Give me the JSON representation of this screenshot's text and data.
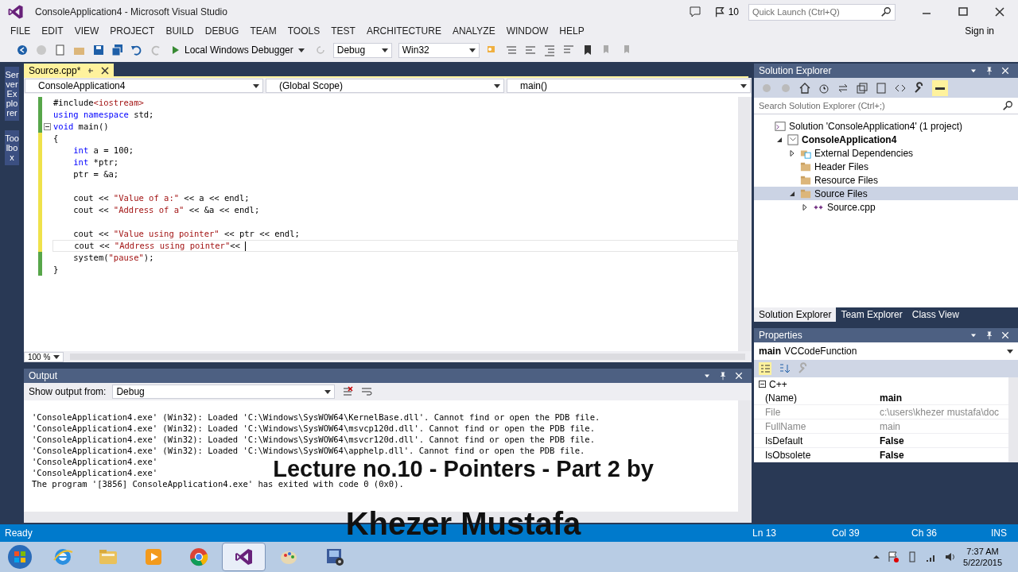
{
  "window": {
    "title": "ConsoleApplication4 - Microsoft Visual Studio",
    "notifications": "10",
    "quick_launch": {
      "placeholder": "Quick Launch (Ctrl+Q)"
    }
  },
  "menu": [
    "FILE",
    "EDIT",
    "VIEW",
    "PROJECT",
    "BUILD",
    "DEBUG",
    "TEAM",
    "TOOLS",
    "TEST",
    "ARCHITECTURE",
    "ANALYZE",
    "WINDOW",
    "HELP"
  ],
  "sign_in": "Sign in",
  "toolbar": {
    "debugger": "Local Windows Debugger",
    "configuration": "Debug",
    "platform": "Win32"
  },
  "side_tabs": [
    "Server Explorer",
    "Toolbox"
  ],
  "editor": {
    "tab": {
      "label": "Source.cpp*",
      "selected": true
    },
    "nav": [
      "ConsoleApplication4",
      "(Global Scope)",
      "main()"
    ],
    "lines": [
      {
        "modified": false,
        "tokens": [
          {
            "kind": "plain",
            "text": "#include"
          },
          {
            "kind": "string",
            "text": "<iostream>"
          }
        ]
      },
      {
        "modified": false,
        "tokens": [
          {
            "kind": "keyword",
            "text": "using namespace"
          },
          {
            "kind": "plain",
            "text": " std;"
          }
        ]
      },
      {
        "modified": false,
        "fold": true,
        "tokens": [
          {
            "kind": "keyword",
            "text": "void"
          },
          {
            "kind": "plain",
            "text": " main()"
          }
        ]
      },
      {
        "modified": true,
        "tokens": [
          {
            "kind": "plain",
            "text": "{"
          }
        ]
      },
      {
        "modified": true,
        "tokens": [
          {
            "kind": "keyword",
            "text": "    int"
          },
          {
            "kind": "plain",
            "text": " a = 100;"
          }
        ]
      },
      {
        "modified": true,
        "tokens": [
          {
            "kind": "keyword",
            "text": "    int"
          },
          {
            "kind": "plain",
            "text": " *ptr;"
          }
        ]
      },
      {
        "modified": true,
        "tokens": [
          {
            "kind": "plain",
            "text": "    ptr = &a;"
          }
        ]
      },
      {
        "modified": true
      },
      {
        "modified": true,
        "tokens": [
          {
            "kind": "plain",
            "text": "    cout << "
          },
          {
            "kind": "string",
            "text": "\"Value of a:\""
          },
          {
            "kind": "plain",
            "text": " << a << endl;"
          }
        ]
      },
      {
        "modified": true,
        "tokens": [
          {
            "kind": "plain",
            "text": "    cout << "
          },
          {
            "kind": "string",
            "text": "\"Address of a\""
          },
          {
            "kind": "plain",
            "text": " << &a << endl;"
          }
        ]
      },
      {
        "modified": true
      },
      {
        "modified": true,
        "tokens": [
          {
            "kind": "plain",
            "text": "    cout << "
          },
          {
            "kind": "string",
            "text": "\"Value using pointer\""
          },
          {
            "kind": "plain",
            "text": " << ptr << endl;"
          }
        ]
      },
      {
        "modified": true,
        "current": true,
        "tokens": [
          {
            "kind": "plain",
            "text": "    cout << "
          },
          {
            "kind": "string",
            "text": "\"Address using pointer\""
          },
          {
            "kind": "plain",
            "text": "<< "
          }
        ]
      },
      {
        "modified": false,
        "tokens": [
          {
            "kind": "plain",
            "text": "    system("
          },
          {
            "kind": "string",
            "text": "\"pause\""
          },
          {
            "kind": "plain",
            "text": ");"
          }
        ]
      },
      {
        "modified": false,
        "tokens": [
          {
            "kind": "plain",
            "text": "}"
          }
        ]
      }
    ],
    "zoom": "100 %"
  },
  "output": {
    "title": "Output",
    "source_label": "Show output from:",
    "source": "Debug",
    "lines": [
      "'ConsoleApplication4.exe' (Win32): Loaded 'C:\\Windows\\SysWOW64\\KernelBase.dll'. Cannot find or open the PDB file.",
      "'ConsoleApplication4.exe' (Win32): Loaded 'C:\\Windows\\SysWOW64\\msvcp120d.dll'. Cannot find or open the PDB file.",
      "'ConsoleApplication4.exe' (Win32): Loaded 'C:\\Windows\\SysWOW64\\msvcr120d.dll'. Cannot find or open the PDB file.",
      "'ConsoleApplication4.exe' (Win32): Loaded 'C:\\Windows\\SysWOW64\\apphelp.dll'. Cannot find or open the PDB file.",
      "'ConsoleApplication4.exe'",
      "'ConsoleApplication4.exe'",
      "The program '[3856] ConsoleApplication4.exe' has exited with code 0 (0x0)."
    ]
  },
  "solution_explorer": {
    "title": "Solution Explorer",
    "search": {
      "placeholder": "Search Solution Explorer (Ctrl+;)"
    },
    "tree": [
      {
        "label": "Solution 'ConsoleApplication4' (1 project)",
        "kind": "solution",
        "selected": false,
        "children": [
          {
            "label": "ConsoleApplication4",
            "kind": "project",
            "expanded": true,
            "selected": false,
            "children": [
              {
                "label": "External Dependencies",
                "kind": "deps",
                "expanded": false,
                "selected": false
              },
              {
                "label": "Header Files",
                "kind": "folder",
                "selected": false
              },
              {
                "label": "Resource Files",
                "kind": "folder",
                "selected": false
              },
              {
                "label": "Source Files",
                "kind": "folder",
                "expanded": true,
                "selected": true,
                "children": [
                  {
                    "label": "Source.cpp",
                    "kind": "cpp",
                    "expanded": false,
                    "selected": false
                  }
                ]
              }
            ]
          }
        ]
      }
    ],
    "tabs": [
      {
        "label": "Solution Explorer",
        "selected": true
      },
      {
        "label": "Team Explorer",
        "selected": false
      },
      {
        "label": "Class View",
        "selected": false
      }
    ]
  },
  "properties": {
    "title": "Properties",
    "object": "main",
    "object_type": "VCCodeFunction",
    "category": "C++",
    "rows": [
      {
        "name": "(Name)",
        "value": "main",
        "bold": true,
        "disabled": false
      },
      {
        "name": "File",
        "value": "c:\\users\\khezer mustafa\\doc",
        "bold": false,
        "disabled": true
      },
      {
        "name": "FullName",
        "value": "main",
        "bold": false,
        "disabled": true
      },
      {
        "name": "IsDefault",
        "value": "False",
        "bold": true,
        "disabled": false
      },
      {
        "name": "IsObsolete",
        "value": "False",
        "bold": true,
        "disabled": false
      }
    ]
  },
  "caption": [
    "Lecture no.10 - Pointers - Part 2 by",
    "Khezer Mustafa"
  ],
  "status_bar": {
    "state": "Ready",
    "line": "Ln 13",
    "column": "Col 39",
    "char": "Ch 36",
    "mode": "INS"
  },
  "taskbar": {
    "apps": [
      {
        "kind": "browser-e",
        "selected": false
      },
      {
        "kind": "folder",
        "selected": false
      },
      {
        "kind": "media",
        "selected": false
      },
      {
        "kind": "chrome",
        "selected": false
      },
      {
        "kind": "vs",
        "selected": true
      },
      {
        "kind": "paint",
        "selected": false
      },
      {
        "kind": "film",
        "selected": false
      }
    ],
    "time": "7:37 AM",
    "date": "5/22/2015"
  }
}
